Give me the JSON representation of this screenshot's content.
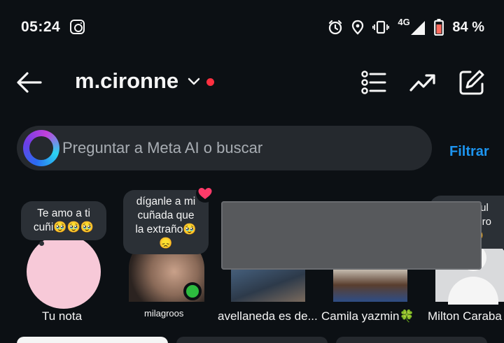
{
  "status_bar": {
    "time": "05:24",
    "network": "4G",
    "battery": "84 %",
    "icons": [
      "instagram-icon",
      "alarm-icon",
      "location-icon",
      "vibrate-icon",
      "signal-icon",
      "battery-icon"
    ]
  },
  "header": {
    "username": "m.cironne",
    "icons": [
      "back-arrow-icon",
      "chevron-down-icon",
      "list-icon",
      "trending-icon",
      "edit-icon"
    ]
  },
  "search": {
    "placeholder": "Preguntar a Meta AI o buscar",
    "filter_label": "Filtrar"
  },
  "notes": [
    {
      "name": "Tu nota",
      "note": "Te amo a ti\ncuñi🥹🥹🥹"
    },
    {
      "name": "milagroos",
      "note": "díganle a mi\ncuñada que\nla extraño🥹\n😞",
      "online": true,
      "liked": true
    },
    {
      "name": "avellaneda es de..."
    },
    {
      "name": "Camila yazmin🍀"
    },
    {
      "name": "Milton Caraba",
      "note": "licul\npero\n🥹"
    }
  ],
  "colors": {
    "background": "#0c1014",
    "search_bg": "#25292e",
    "accent_blue": "#1d95f0",
    "online_green": "#2dbb3f",
    "notification_red": "#ff3040"
  }
}
